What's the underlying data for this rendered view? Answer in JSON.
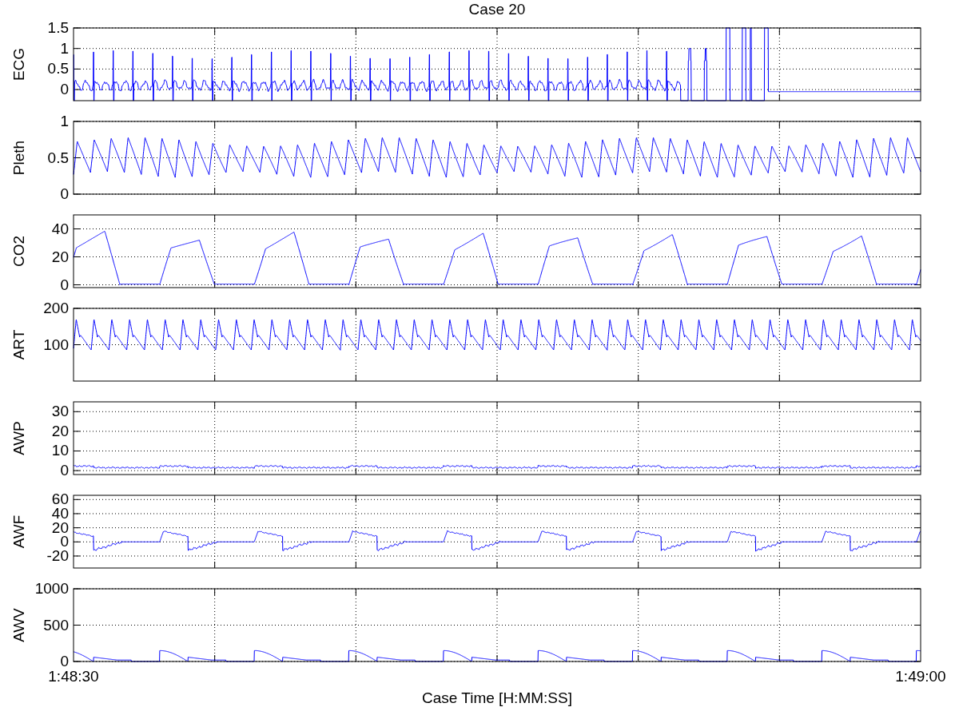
{
  "title": "Case 20",
  "panels": [
    {
      "kind": "ecg",
      "ylabel": "ECG",
      "yticks": [
        "1.5",
        "1",
        "0.5",
        "0"
      ]
    },
    {
      "kind": "pleth",
      "ylabel": "Pleth",
      "yticks": [
        "1",
        "0.5",
        "0"
      ]
    },
    {
      "kind": "co2",
      "ylabel": "CO2",
      "yticks": [
        "40",
        "20",
        "0"
      ]
    },
    {
      "kind": "art",
      "ylabel": "ART",
      "yticks": [
        "200",
        "100"
      ]
    },
    {
      "kind": "awp",
      "ylabel": "AWP",
      "yticks": [
        "30",
        "20",
        "10",
        "0"
      ]
    },
    {
      "kind": "awf",
      "ylabel": "AWF",
      "yticks": [
        "60",
        "40",
        "20",
        "0",
        "-20"
      ]
    },
    {
      "kind": "awv",
      "ylabel": "AWV",
      "yticks": [
        "1000",
        "500",
        "0"
      ]
    }
  ],
  "xticks": [
    "1:48:30",
    "1:49:00"
  ],
  "xlabel": "Case Time [H:MM:SS]"
}
